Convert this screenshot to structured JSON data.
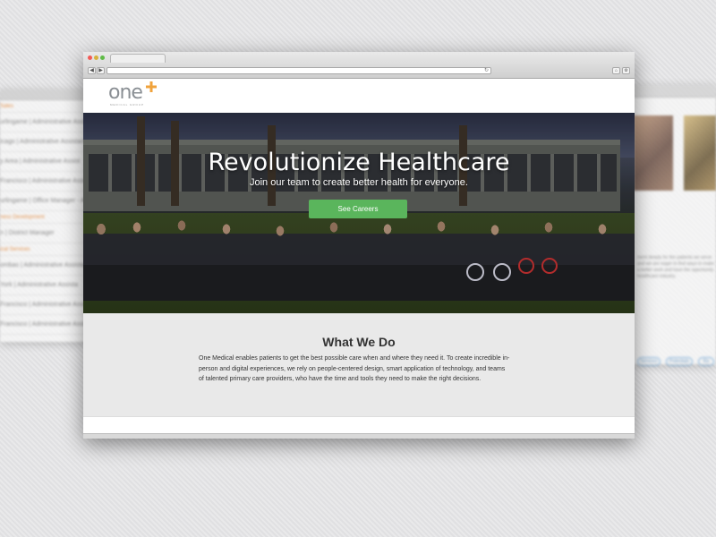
{
  "background_windows": {
    "left": {
      "rows": [
        {
          "text": "Sales",
          "category": true
        },
        {
          "text": "urlingame | Administrative Assist",
          "category": false
        },
        {
          "text": "icago | Administrative Assistant",
          "category": false
        },
        {
          "text": "y Area | Administrative Assist",
          "category": false
        },
        {
          "text": "Francisco | Administrative Assis",
          "category": false
        },
        {
          "text": "urlingame | Office Manager - Ad",
          "category": false
        },
        {
          "text": "ness Development",
          "category": true
        },
        {
          "text": "n | District Manager",
          "category": false
        },
        {
          "text": "ical Services",
          "category": true
        },
        {
          "text": "ombas | Administrative Assista",
          "category": false
        },
        {
          "text": "York | Administrative Assista",
          "category": false
        },
        {
          "text": "Francisco | Administrative Assis",
          "category": false
        },
        {
          "text": "Francisco | Administrative Assis",
          "category": false
        }
      ]
    },
    "right": {
      "text": "ment deeply for the patients we serve and we are eager to find ways to make a better work and have the opportunity healthcare industry.",
      "pills": [
        "Services",
        "Potentials",
        "Ra"
      ]
    }
  },
  "browser": {
    "nav_back": "◀",
    "nav_forward": "▶",
    "reload_icon": "↻",
    "home_icon": "⌂",
    "gear_icon": "⚙"
  },
  "site": {
    "logo_text": "one",
    "logo_subtext": "MEDICAL GROUP",
    "logo_accent_color": "#f0a33c",
    "hero": {
      "title": "Revolutionize Healthcare",
      "subtitle": "Join our team to create better health for everyone.",
      "cta_label": "See Careers",
      "cta_color": "#5ab55c"
    },
    "what_we_do": {
      "title": "What We Do",
      "body": "One Medical enables patients to get the best possible care when and where they need it. To create incredible in-person and digital experiences, we rely on people-centered design, smart application of technology, and teams of talented primary care providers, who have the time and tools they need to make the right decisions."
    }
  }
}
